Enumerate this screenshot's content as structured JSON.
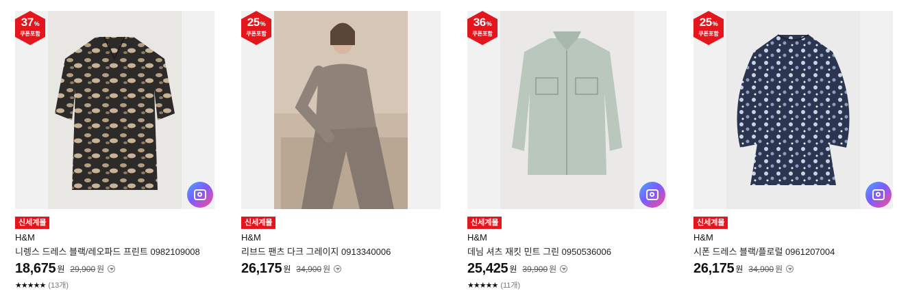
{
  "products": [
    {
      "discount": "37",
      "discount_unit": "%",
      "coupon_label": "쿠폰포함",
      "tag": "신세계몰",
      "brand": "H&M",
      "name": "니렝스 드레스 블랙/레오파드 프린트 0982109008",
      "price": "18,675",
      "currency": "원",
      "original_price": "29,900",
      "original_currency": "원",
      "rating_stars": "★★★★★",
      "review_count": "(13개)",
      "image": "leopard-print-dress"
    },
    {
      "discount": "25",
      "discount_unit": "%",
      "coupon_label": "쿠폰포함",
      "tag": "신세계몰",
      "brand": "H&M",
      "name": "리브드 팬츠 다크 그레이지 0913340006",
      "price": "26,175",
      "currency": "원",
      "original_price": "34,900",
      "original_currency": "원",
      "image": "model-ribbed-pants"
    },
    {
      "discount": "36",
      "discount_unit": "%",
      "coupon_label": "쿠폰포함",
      "tag": "신세계몰",
      "brand": "H&M",
      "name": "데님 셔츠 재킷 민트 그린 0950536006",
      "price": "25,425",
      "currency": "원",
      "original_price": "39,900",
      "original_currency": "원",
      "rating_stars": "★★★★★",
      "review_count": "(11개)",
      "image": "mint-denim-shirt-jacket"
    },
    {
      "discount": "25",
      "discount_unit": "%",
      "coupon_label": "쿠폰포함",
      "tag": "신세계몰",
      "brand": "H&M",
      "name": "시폰 드레스 블랙/플로럴 0961207004",
      "price": "26,175",
      "currency": "원",
      "original_price": "34,900",
      "original_currency": "원",
      "image": "floral-chiffon-dress"
    }
  ],
  "colors": {
    "accent_red": "#e4161d",
    "badge_text": "#ffffff"
  },
  "icons": {
    "lens": "camera-lens-search-icon",
    "info": "info-chevron-icon"
  }
}
